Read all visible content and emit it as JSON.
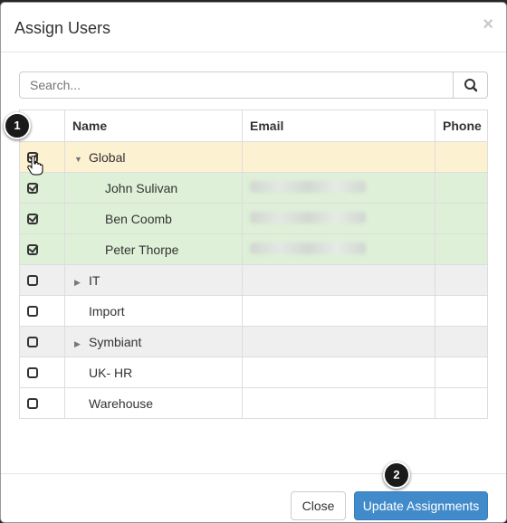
{
  "modal": {
    "title": "Assign Users",
    "close_symbol": "×"
  },
  "search": {
    "placeholder": "Search...",
    "icon": "search-icon"
  },
  "table": {
    "headers": [
      "",
      "Name",
      "Email",
      "Phone"
    ],
    "rows": [
      {
        "name": "Global",
        "checked": true,
        "expander": "▼",
        "style": "yellow"
      },
      {
        "name": "John Sulivan",
        "checked": true,
        "style": "green",
        "email_redacted": true
      },
      {
        "name": "Ben Coomb",
        "checked": true,
        "style": "green",
        "email_redacted": true
      },
      {
        "name": "Peter Thorpe",
        "checked": true,
        "style": "green",
        "email_redacted": true
      },
      {
        "name": "IT",
        "checked": false,
        "expander": "▶",
        "style": "gray"
      },
      {
        "name": "Import",
        "checked": false,
        "style": "white"
      },
      {
        "name": "Symbiant",
        "checked": false,
        "expander": "▶",
        "style": "gray"
      },
      {
        "name": "UK- HR",
        "checked": false,
        "style": "white"
      },
      {
        "name": "Warehouse",
        "checked": false,
        "style": "white"
      }
    ]
  },
  "buttons": {
    "close": "Close",
    "update": "Update Assignments"
  },
  "annotations": {
    "step1": "1",
    "step2": "2"
  },
  "colors": {
    "primary": "#428bca",
    "row_selected_group": "#fcf1d1",
    "row_selected": "#dff0d8",
    "row_group": "#efefef"
  }
}
